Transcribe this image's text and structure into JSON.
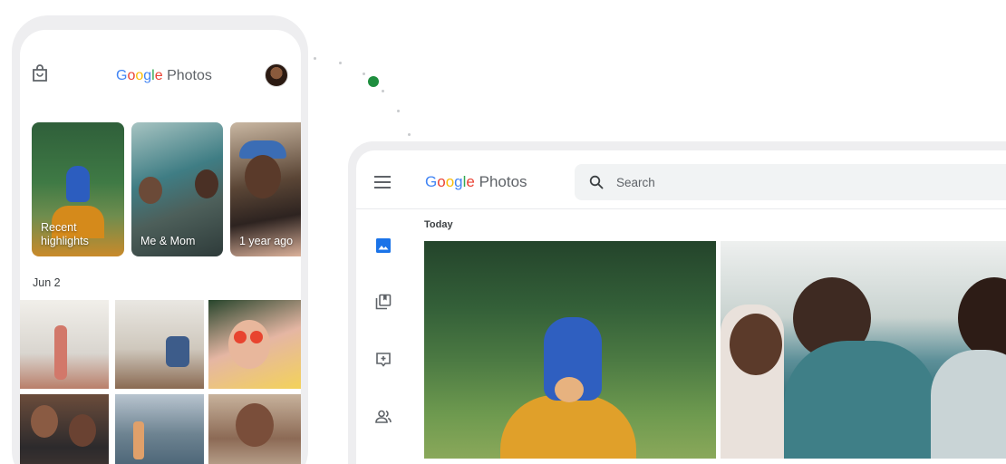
{
  "phone": {
    "brand": {
      "g1": "G",
      "o1": "o",
      "o2": "o",
      "g2": "g",
      "l": "l",
      "e": "e",
      "product": " Photos"
    },
    "highlights": [
      {
        "label": "Recent highlights"
      },
      {
        "label": "Me & Mom"
      },
      {
        "label": "1 year ago"
      }
    ],
    "date_section": "Jun 2"
  },
  "desktop": {
    "brand": {
      "g1": "G",
      "o1": "o",
      "o2": "o",
      "g2": "g",
      "l": "l",
      "e": "e",
      "product": " Photos"
    },
    "search": {
      "placeholder": "Search"
    },
    "section_label": "Today",
    "nav_icons": [
      "photos-icon",
      "albums-icon",
      "add-to-album-icon",
      "people-icon"
    ]
  },
  "colors": {
    "google_blue": "#4285f4",
    "google_red": "#ea4335",
    "google_yellow": "#fbbc05",
    "google_green": "#34a853",
    "accent_dot": "#1e8e3e"
  }
}
